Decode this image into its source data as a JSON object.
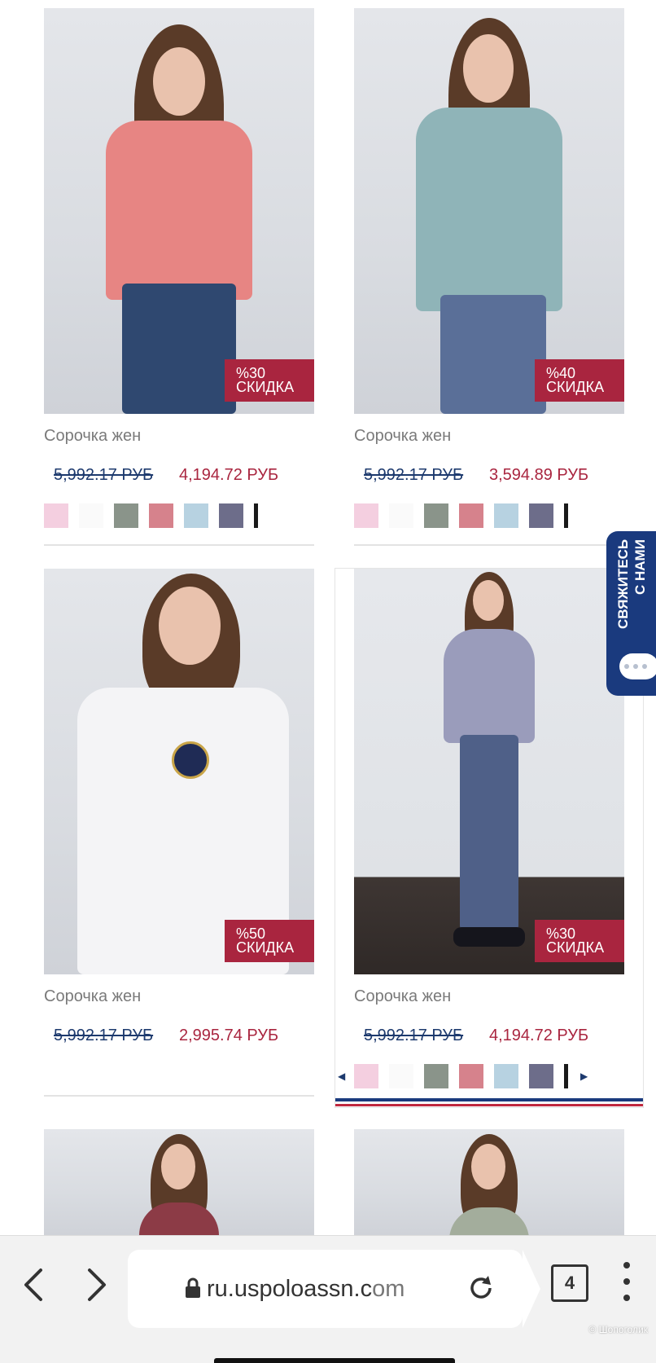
{
  "products": [
    {
      "title": "Сорочка жен",
      "old_price": "5,992.17 РУБ",
      "new_price": "4,194.72 РУБ",
      "discount_pct": "%30",
      "discount_word": "СКИДКА",
      "shirt_color": "#e78583",
      "pants_color": "#2f4870"
    },
    {
      "title": "Сорочка жен",
      "old_price": "5,992.17 РУБ",
      "new_price": "3,594.89 РУБ",
      "discount_pct": "%40",
      "discount_word": "СКИДКА",
      "shirt_color": "#8fb4b8",
      "pants_color": "#5a6f98"
    },
    {
      "title": "Сорочка жен",
      "old_price": "5,992.17 РУБ",
      "new_price": "2,995.74 РУБ",
      "discount_pct": "%50",
      "discount_word": "СКИДКА",
      "shirt_color": "#f4f4f6",
      "pants_color": "#f4f4f6"
    },
    {
      "title": "Сорочка жен",
      "old_price": "5,992.17 РУБ",
      "new_price": "4,194.72 РУБ",
      "discount_pct": "%30",
      "discount_word": "СКИДКА",
      "shirt_color": "#9a9cbb",
      "pants_color": "#4f6088"
    }
  ],
  "swatch_colors": [
    "#f4cfe0",
    "#fafafa",
    "#8a948a",
    "#d6828c",
    "#b7d2e1",
    "#6d6d8a"
  ],
  "contact_tab": {
    "line1": "СВЯЖИТЕСЬ",
    "line2": "С НАМИ"
  },
  "browser": {
    "url_main": "ru.uspoloassn.c",
    "url_dim": "om",
    "tab_count": "4"
  },
  "watermark": "© Шопоголик"
}
